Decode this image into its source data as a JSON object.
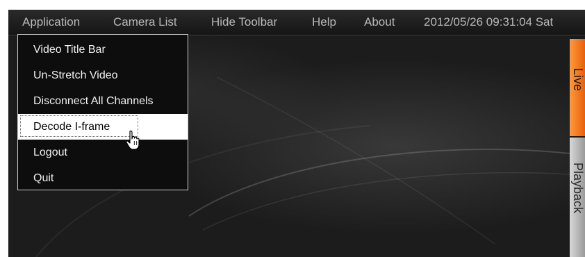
{
  "menubar": {
    "items": [
      {
        "label": "Application"
      },
      {
        "label": "Camera List"
      },
      {
        "label": "Hide Toolbar"
      },
      {
        "label": "Help"
      },
      {
        "label": "About"
      }
    ],
    "datetime": "2012/05/26 09:31:04 Sat"
  },
  "application_menu": {
    "items": [
      {
        "label": "Video Title Bar"
      },
      {
        "label": "Un-Stretch Video"
      },
      {
        "label": "Disconnect All Channels"
      },
      {
        "label": "Decode I-frame",
        "highlighted": true
      },
      {
        "label": "Logout"
      },
      {
        "label": "Quit"
      }
    ]
  },
  "side_tabs": {
    "live": "Live",
    "playback": "Playback",
    "active": "Live"
  },
  "colors": {
    "live_tab": "#f07a20",
    "playback_tab": "#b8b8b8",
    "background": "#1c1c1c",
    "menu_text": "#b8b8b8"
  },
  "icons": {
    "cursor": "hand-pointer-icon"
  }
}
